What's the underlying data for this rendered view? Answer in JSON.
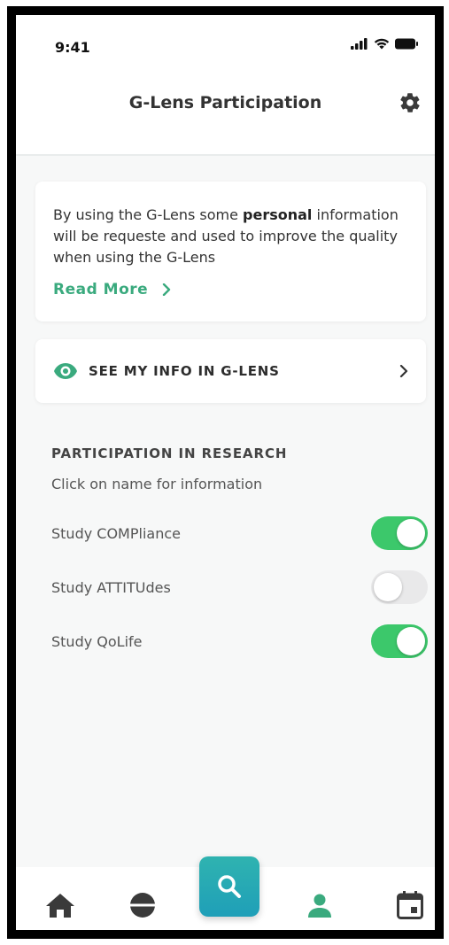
{
  "status_bar": {
    "time": "9:41"
  },
  "header": {
    "title": "G-Lens Participation"
  },
  "info_card": {
    "text_before": "By using the G-Lens some ",
    "text_bold": "personal",
    "text_after": " information will be requeste and used to improve the quality when using the G-Lens",
    "read_more_label": "Read More"
  },
  "see_info": {
    "label": "SEE MY INFO IN G-LENS"
  },
  "research": {
    "title": "PARTICIPATION IN RESEARCH",
    "subtitle": "Click on name for information",
    "studies": [
      {
        "label": "Study COMPliance",
        "enabled": true
      },
      {
        "label": "Study ATTITUdes",
        "enabled": false
      },
      {
        "label": "Study QoLife",
        "enabled": true
      }
    ]
  },
  "bottom_nav": {
    "items": [
      "home-icon",
      "pill-icon",
      "search-icon",
      "person-icon",
      "calendar-icon"
    ],
    "active": "person-icon"
  },
  "colors": {
    "accent_green": "#3aaa7e",
    "toggle_on": "#3cc86b",
    "search_fab": "#24a9b5"
  }
}
